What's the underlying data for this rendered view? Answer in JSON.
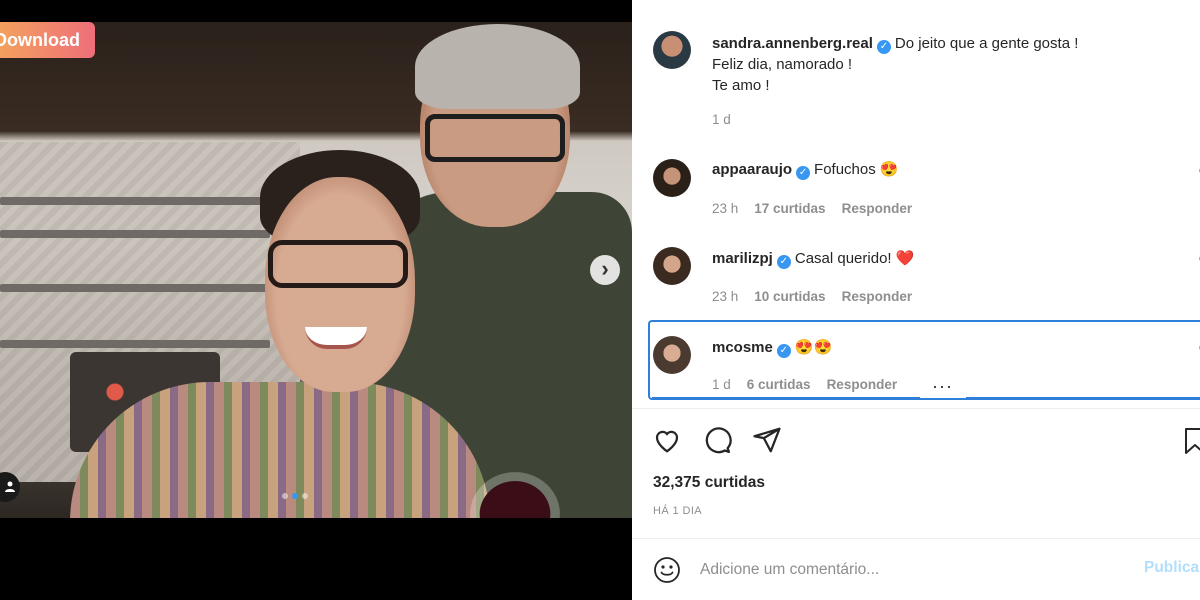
{
  "media": {
    "download_label": "Download",
    "next_arrow": "›",
    "carousel": {
      "count": 3,
      "active": 1
    },
    "icons": [
      "chevron-right-icon",
      "user-tag-icon"
    ]
  },
  "post": {
    "author": "sandra.annenberg.real",
    "caption_line1": "Do jeito que a gente gosta !",
    "caption_line2": "Feliz dia, namorado !",
    "caption_line3": "Te amo !",
    "time": "1 d"
  },
  "comments": [
    {
      "user": "appaaraujo",
      "text": "Fofuchos 😍",
      "time": "23 h",
      "likes": "17 curtidas",
      "reply": "Responder"
    },
    {
      "user": "marilizpj",
      "text": "Casal querido! ❤️",
      "time": "23 h",
      "likes": "10 curtidas",
      "reply": "Responder"
    },
    {
      "user": "mcosme",
      "text": "😍😍",
      "time": "1 d",
      "likes": "6 curtidas",
      "reply": "Responder",
      "more": "···"
    }
  ],
  "actions": {
    "icons": [
      "heart-icon",
      "comment-icon",
      "share-icon",
      "bookmark-icon"
    ]
  },
  "likes_count": "32,375 curtidas",
  "date_label": "HÁ 1 DIA",
  "comment_box": {
    "placeholder": "Adicione um comentário...",
    "publish_label": "Publicar"
  },
  "colors": {
    "verified": "#3897f0",
    "focus": "#2d7fd9",
    "publish_disabled": "#b2dffc",
    "download_gradient": [
      "#f3a15e",
      "#ee6e7a"
    ]
  }
}
